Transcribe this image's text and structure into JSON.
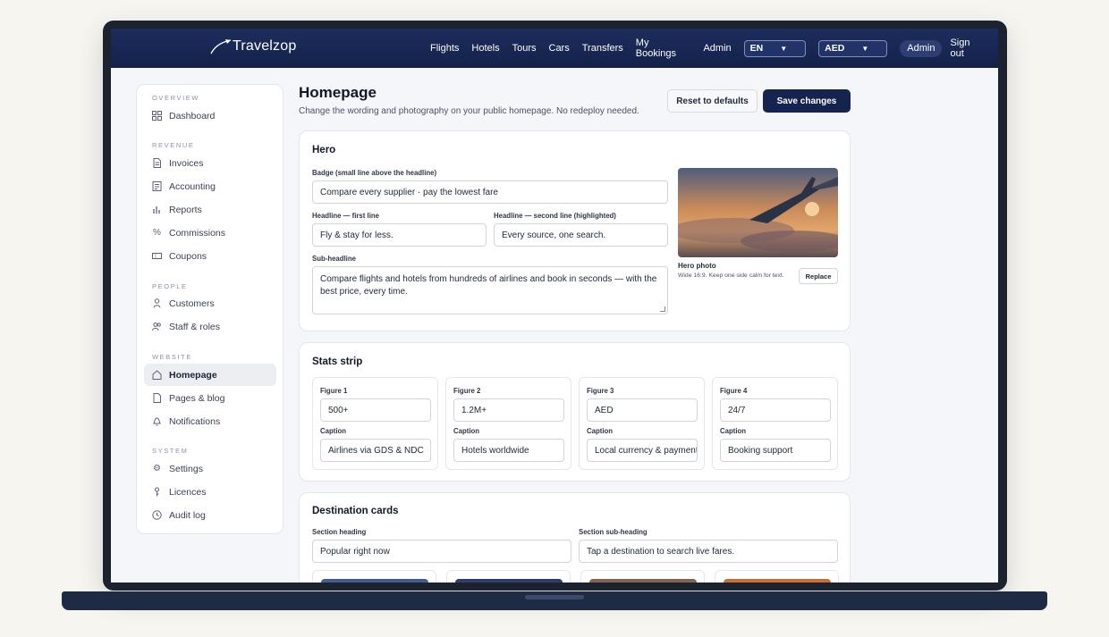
{
  "brand": {
    "name": "Travelzop"
  },
  "nav": {
    "links": [
      "Flights",
      "Hotels",
      "Tours",
      "Cars",
      "Transfers",
      "My Bookings",
      "Admin"
    ],
    "language": "EN",
    "currency": "AED",
    "user": "Admin",
    "signout": "Sign out"
  },
  "sidebar": {
    "sections": [
      {
        "title": "OVERVIEW",
        "items": [
          {
            "label": "Dashboard",
            "icon": "dashboard-icon"
          }
        ]
      },
      {
        "title": "REVENUE",
        "items": [
          {
            "label": "Invoices",
            "icon": "invoice-icon"
          },
          {
            "label": "Accounting",
            "icon": "ledger-icon"
          },
          {
            "label": "Reports",
            "icon": "bar-chart-icon"
          },
          {
            "label": "Commissions",
            "icon": "percent-icon"
          },
          {
            "label": "Coupons",
            "icon": "ticket-icon"
          }
        ]
      },
      {
        "title": "PEOPLE",
        "items": [
          {
            "label": "Customers",
            "icon": "user-icon"
          },
          {
            "label": "Staff & roles",
            "icon": "users-icon"
          }
        ]
      },
      {
        "title": "WEBSITE",
        "items": [
          {
            "label": "Homepage",
            "icon": "home-icon",
            "active": true
          },
          {
            "label": "Pages & blog",
            "icon": "page-icon"
          },
          {
            "label": "Notifications",
            "icon": "bell-icon"
          }
        ]
      },
      {
        "title": "SYSTEM",
        "items": [
          {
            "label": "Settings",
            "icon": "gear-icon"
          },
          {
            "label": "Licences",
            "icon": "key-icon"
          },
          {
            "label": "Audit log",
            "icon": "clock-icon"
          }
        ]
      }
    ]
  },
  "page": {
    "title": "Homepage",
    "subtitle": "Change the wording and photography on your public homepage. No redeploy needed.",
    "reset_label": "Reset to defaults",
    "save_label": "Save changes"
  },
  "hero": {
    "title": "Hero",
    "badge_label": "Badge (small line above the headline)",
    "badge_value": "Compare every supplier · pay the lowest fare",
    "headline1_label": "Headline — first line",
    "headline1_value": "Fly & stay for less.",
    "headline2_label": "Headline — second line (highlighted)",
    "headline2_value": "Every source, one search.",
    "subheadline_label": "Sub-headline",
    "subheadline_value": "Compare flights and hotels from hundreds of airlines and book in seconds — with the best price, every time.",
    "photo_label": "Hero photo",
    "photo_hint": "Wide 16:9. Keep one side calm for text.",
    "replace_label": "Replace"
  },
  "stats": {
    "title": "Stats strip",
    "figure_labels": [
      "Figure 1",
      "Figure 2",
      "Figure 3",
      "Figure 4"
    ],
    "caption_label": "Caption",
    "figures": [
      "500+",
      "1.2M+",
      "AED",
      "24/7"
    ],
    "captions": [
      "Airlines via GDS & NDC",
      "Hotels worldwide",
      "Local currency & payment",
      "Booking support"
    ]
  },
  "destinations": {
    "title": "Destination cards",
    "heading_label": "Section heading",
    "heading_value": "Popular right now",
    "subheading_label": "Section sub-heading",
    "subheading_value": "Tap a destination to search live fares."
  }
}
